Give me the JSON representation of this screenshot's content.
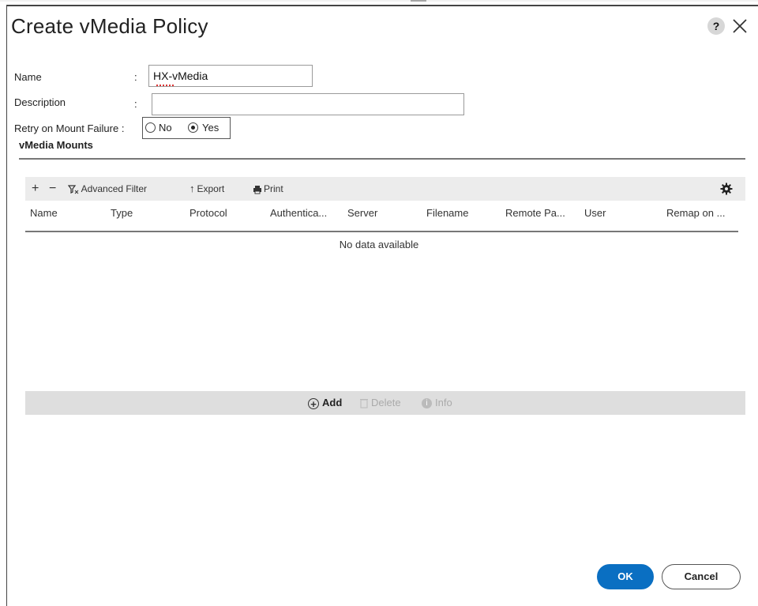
{
  "dialog": {
    "title": "Create vMedia Policy",
    "help_icon": "?",
    "close_icon": "close-icon"
  },
  "form": {
    "name_label": "Name",
    "name_value": "HX-vMedia",
    "description_label": "Description",
    "description_value": "",
    "retry_label": "Retry on Mount Failure :",
    "retry_options": [
      "No",
      "Yes"
    ],
    "retry_selected": "Yes",
    "colon": ":"
  },
  "mounts": {
    "section_title": "vMedia Mounts",
    "toolbar": {
      "add_icon": "+",
      "remove_icon": "−",
      "advanced_filter": "Advanced Filter",
      "export": "Export",
      "print": "Print",
      "settings_icon": "gear-icon"
    },
    "columns": [
      "Name",
      "Type",
      "Protocol",
      "Authentica...",
      "Server",
      "Filename",
      "Remote Pa...",
      "User",
      "Remap on ..."
    ],
    "empty_message": "No data available",
    "footer": {
      "add": "Add",
      "delete": "Delete",
      "info": "Info"
    }
  },
  "buttons": {
    "ok": "OK",
    "cancel": "Cancel"
  },
  "colors": {
    "primary": "#0a6fc2",
    "toolbar_bg": "#ececec",
    "footer_bg": "#dedede"
  }
}
